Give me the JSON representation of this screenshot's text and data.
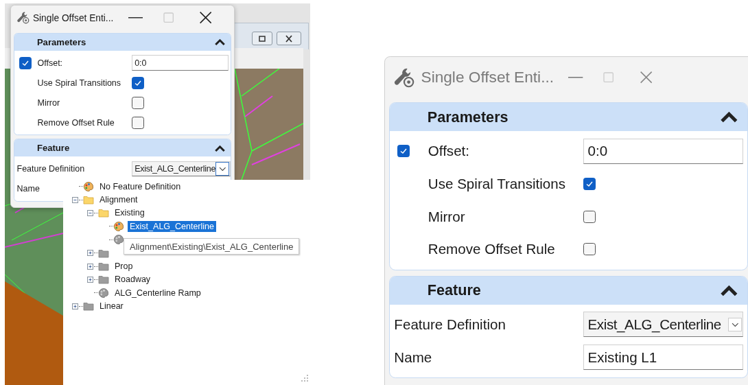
{
  "left_screenshot": {
    "dialog": {
      "title": "Single Offset Enti...",
      "active": true,
      "sections": [
        {
          "title": "Parameters",
          "expanded": true,
          "rows": [
            {
              "kind": "checkbox_field",
              "label": "Offset:",
              "checked": true,
              "value": "0:0"
            },
            {
              "kind": "checkbox",
              "label": "Use Spiral Transitions",
              "checked": true
            },
            {
              "kind": "checkbox",
              "label": "Mirror",
              "checked": false
            },
            {
              "kind": "checkbox",
              "label": "Remove Offset Rule",
              "checked": false
            }
          ]
        },
        {
          "title": "Feature",
          "expanded": true,
          "rows": [
            {
              "kind": "dropdown",
              "label": "Feature Definition",
              "value": "Exist_ALG_Centerline"
            },
            {
              "kind": "text",
              "label": "Name"
            }
          ]
        }
      ]
    },
    "feature_tree": [
      {
        "kind": "feature",
        "label": "No Feature Definition",
        "selected": false
      },
      {
        "kind": "folder",
        "label": "Alignment",
        "expanded": true,
        "selected": false,
        "children": [
          {
            "kind": "folder",
            "label": "Existing",
            "expanded": true,
            "selected": false,
            "children": [
              {
                "kind": "feature",
                "label": "Exist_ALG_Centerline",
                "selected": true
              },
              {
                "kind": "feature_gray"
              }
            ]
          },
          {
            "kind": "folder",
            "expanded": false
          },
          {
            "kind": "folder",
            "label": "Prop",
            "expanded": false,
            "selected": false
          },
          {
            "kind": "folder",
            "label": "Roadway",
            "expanded": false,
            "selected": false
          },
          {
            "kind": "feature_gray",
            "label": "ALG_Centerline Ramp",
            "selected": false
          }
        ]
      },
      {
        "kind": "folder",
        "label": "Linear",
        "expanded": false,
        "selected": false
      }
    ],
    "tooltip": "Alignment\\Existing\\Exist_ALG_Centerline"
  },
  "right_screenshot": {
    "dialog": {
      "title": "Single Offset Enti...",
      "active": false,
      "sections": [
        {
          "title": "Parameters",
          "expanded": true,
          "rows": [
            {
              "kind": "checkbox_field",
              "label": "Offset:",
              "checked": true,
              "value": "0:0"
            },
            {
              "kind": "checkbox",
              "label": "Use Spiral Transitions",
              "checked": true
            },
            {
              "kind": "checkbox",
              "label": "Mirror",
              "checked": false
            },
            {
              "kind": "checkbox",
              "label": "Remove Offset Rule",
              "checked": false
            }
          ]
        },
        {
          "title": "Feature",
          "expanded": true,
          "rows": [
            {
              "kind": "dropdown",
              "label": "Feature Definition",
              "value": "Exist_ALG_Centerline"
            },
            {
              "kind": "text",
              "label": "Name",
              "value": "Existing L1"
            }
          ]
        }
      ]
    }
  }
}
